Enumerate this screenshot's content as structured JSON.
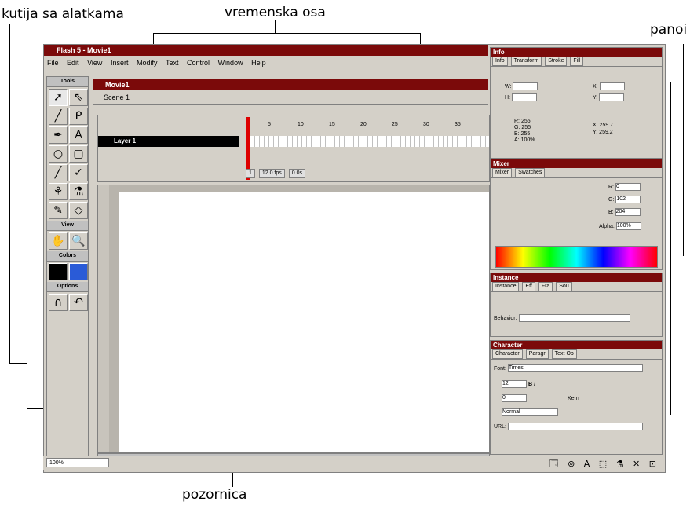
{
  "annotations": {
    "toolbox": "kutija sa alatkama",
    "timeline": "vremenska osa",
    "panels": "panoi",
    "stage": "pozornica"
  },
  "app": {
    "title": "Flash 5 - Movie1",
    "menu": [
      "File",
      "Edit",
      "View",
      "Insert",
      "Modify",
      "Text",
      "Control",
      "Window",
      "Help"
    ]
  },
  "toolbox": {
    "tools_header": "Tools",
    "view_header": "View",
    "colors_header": "Colors",
    "options_header": "Options",
    "tools": [
      "➚",
      "⇖",
      "╱",
      "ᑭ",
      "✒",
      "A",
      "○",
      "▢",
      "╱",
      "✓",
      "⚘",
      "⚗",
      "✎",
      "◇"
    ],
    "view": [
      "✋",
      "🔍"
    ]
  },
  "movie": {
    "title": "Movie1",
    "scene": "Scene 1",
    "layer": "Layer 1",
    "ruler": [
      "5",
      "10",
      "15",
      "20",
      "25",
      "30",
      "35"
    ],
    "frame": "1",
    "fps": "12.0 fps",
    "time": "0.0s"
  },
  "bottom": {
    "zoom": "100%",
    "launcher_icons": "🗔 ⊚ A ⬚ ⚗ ✕ ⊡"
  },
  "info_panel": {
    "title": "Info",
    "tabs": [
      "Info",
      "Transform",
      "Stroke",
      "Fill"
    ],
    "w_label": "W:",
    "h_label": "H:",
    "x_label": "X:",
    "y_label": "Y:",
    "r": "R: 255",
    "g": "G: 255",
    "b": "B: 255",
    "a": "A: 100%",
    "cx": "X: 259.7",
    "cy": "Y: 259.2"
  },
  "mixer_panel": {
    "title": "Mixer",
    "tabs": [
      "Mixer",
      "Swatches"
    ],
    "r_label": "R:",
    "r_val": "0",
    "g_label": "G:",
    "g_val": "102",
    "b_label": "B:",
    "b_val": "204",
    "alpha_label": "Alpha:",
    "alpha_val": "100%"
  },
  "instance_panel": {
    "title": "Instance",
    "tabs": [
      "Instance",
      "Eff",
      "Fra",
      "Sou"
    ],
    "behavior_label": "Behavior:"
  },
  "character_panel": {
    "title": "Character",
    "tabs": [
      "Character",
      "Paragr",
      "Text Op"
    ],
    "font_label": "Font:",
    "font_val": "Times",
    "size_val": "12",
    "tracking_val": "0",
    "kern_label": "Kern",
    "baseline_val": "Normal",
    "url_label": "URL:"
  }
}
